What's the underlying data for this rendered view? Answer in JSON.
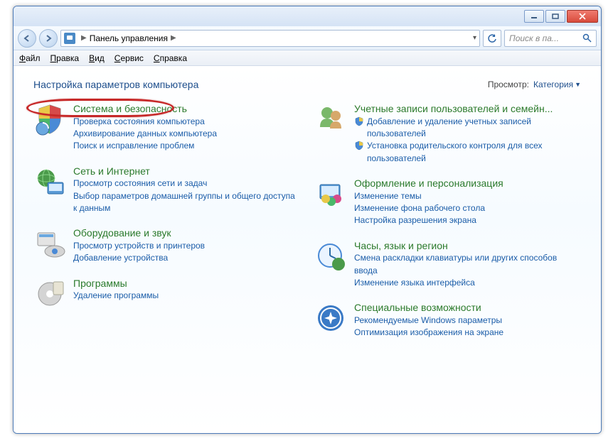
{
  "titlebar": {},
  "addressbar": {
    "crumb": "Панель управления"
  },
  "searchbox": {
    "placeholder": "Поиск в па..."
  },
  "menubar": {
    "file": "Файл",
    "edit": "Правка",
    "view": "Вид",
    "service": "Сервис",
    "help": "Справка"
  },
  "header": {
    "title": "Настройка параметров компьютера",
    "view_label": "Просмотр:",
    "view_value": "Категория"
  },
  "categories": {
    "system_security": {
      "title": "Система и безопасность",
      "links": [
        "Проверка состояния компьютера",
        "Архивирование данных компьютера",
        "Поиск и исправление проблем"
      ]
    },
    "network": {
      "title": "Сеть и Интернет",
      "links": [
        "Просмотр состояния сети и задач",
        "Выбор параметров домашней группы и общего доступа к данным"
      ]
    },
    "hardware": {
      "title": "Оборудование и звук",
      "links": [
        "Просмотр устройств и принтеров",
        "Добавление устройства"
      ]
    },
    "programs": {
      "title": "Программы",
      "links": [
        "Удаление программы"
      ]
    },
    "accounts": {
      "title": "Учетные записи пользователей и семейн...",
      "links": [
        "Добавление и удаление учетных записей пользователей",
        "Установка родительского контроля для всех пользователей"
      ]
    },
    "appearance": {
      "title": "Оформление и персонализация",
      "links": [
        "Изменение темы",
        "Изменение фона рабочего стола",
        "Настройка разрешения экрана"
      ]
    },
    "clock": {
      "title": "Часы, язык и регион",
      "links": [
        "Смена раскладки клавиатуры или других способов ввода",
        "Изменение языка интерфейса"
      ]
    },
    "ease": {
      "title": "Специальные возможности",
      "links": [
        "Рекомендуемые Windows параметры",
        "Оптимизация изображения на экране"
      ]
    }
  }
}
